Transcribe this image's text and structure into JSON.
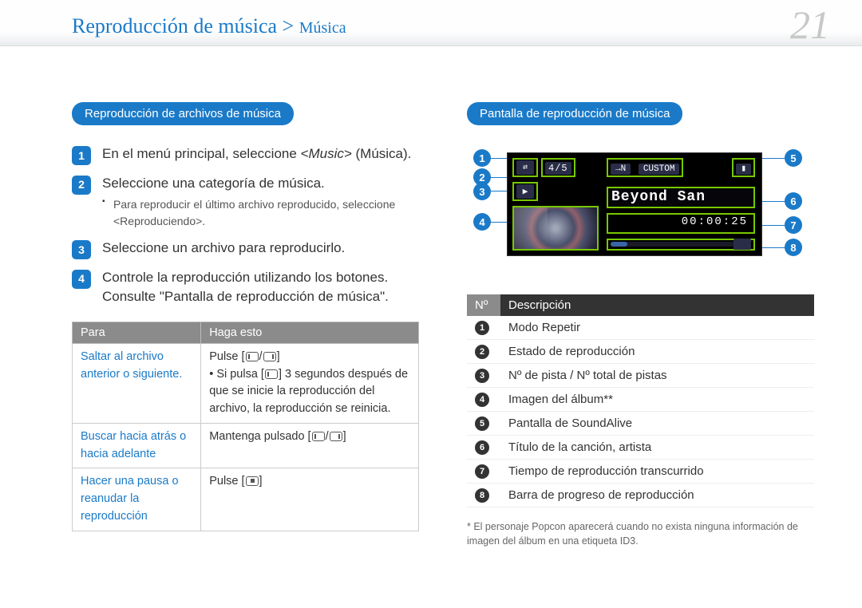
{
  "page_number": "21",
  "breadcrumb": {
    "main": "Reproducción de música",
    "sep": " > ",
    "sub": "Música"
  },
  "left": {
    "section_title": "Reproducción de archivos de música",
    "steps": [
      {
        "n": "1",
        "text_pre": "En el menú principal, seleccione ",
        "text_em": "<Music>",
        "text_post": " (Música)."
      },
      {
        "n": "2",
        "text": "Seleccione una categoría de música.",
        "sub": "Para reproducir el último archivo reproducido, seleccione <Reproduciendo>."
      },
      {
        "n": "3",
        "text": "Seleccione un archivo para reproducirlo."
      },
      {
        "n": "4",
        "text": "Controle la reproducción utilizando los botones. Consulte \"Pantalla de reproducción de música\"."
      }
    ],
    "table": {
      "head_para": "Para",
      "head_haga": "Haga esto",
      "rows": [
        {
          "para": "Saltar al archivo anterior o siguiente.",
          "haga_line1": "Pulse [",
          "haga_line1_end": "]",
          "haga_bullet": "Si pulsa [",
          "haga_bullet_mid": "] 3 segundos después de que se inicie la reproducción del archivo, la reproducción se reinicia."
        },
        {
          "para": "Buscar hacia atrás o hacia adelante",
          "haga": "Mantenga pulsado [",
          "haga_end": "]"
        },
        {
          "para": "Hacer una pausa o reanudar la reproducción",
          "haga": "Pulse [",
          "haga_end": "]"
        }
      ]
    }
  },
  "right": {
    "section_title": "Pantalla de reproducción de música",
    "screen": {
      "track_counter": "4/5",
      "soundalive_arrow": "→N",
      "soundalive_label": "CUSTOM",
      "title": "Beyond San",
      "time": "00:00:25"
    },
    "callouts": [
      "1",
      "2",
      "3",
      "4",
      "5",
      "6",
      "7",
      "8"
    ],
    "desc_table": {
      "head_num": "Nº",
      "head_desc": "Descripción",
      "rows": [
        {
          "n": "1",
          "d": "Modo Repetir"
        },
        {
          "n": "2",
          "d": "Estado de reproducción"
        },
        {
          "n": "3",
          "d": "Nº de pista / Nº total de pistas"
        },
        {
          "n": "4",
          "d": "Imagen del álbum**"
        },
        {
          "n": "5",
          "d": "Pantalla de SoundAlive"
        },
        {
          "n": "6",
          "d": "Título de la canción, artista"
        },
        {
          "n": "7",
          "d": "Tiempo de reproducción transcurrido"
        },
        {
          "n": "8",
          "d": "Barra de progreso de reproducción"
        }
      ]
    },
    "footnote": "* El personaje Popcon aparecerá cuando no exista ninguna información de imagen del álbum en una etiqueta ID3."
  }
}
